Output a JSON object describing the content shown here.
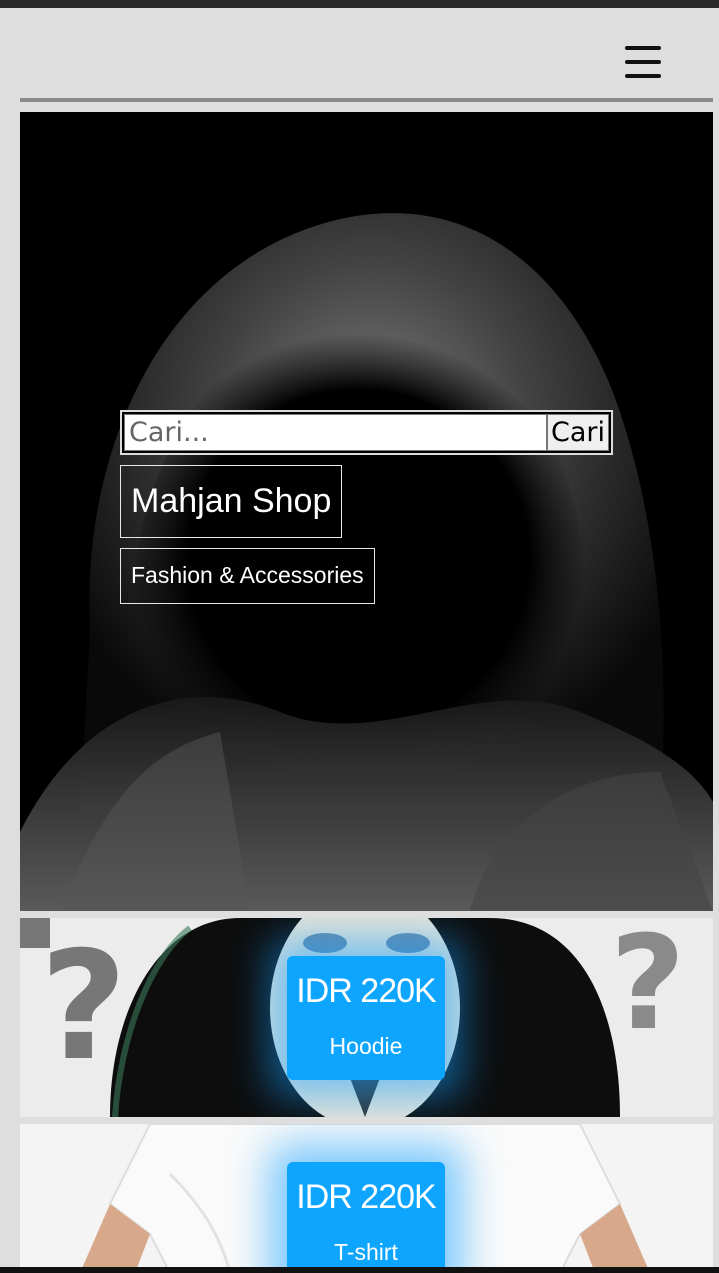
{
  "header": {
    "menu_icon": "hamburger-menu-icon"
  },
  "hero": {
    "search": {
      "placeholder": "Cari...",
      "button_label": "Cari"
    },
    "brand_name": "Mahjan Shop",
    "tagline": "Fashion & Accessories"
  },
  "products": [
    {
      "price": "IDR 220K",
      "name": "Hoodie"
    },
    {
      "price": "IDR 220K",
      "name": "T-shirt"
    }
  ],
  "colors": {
    "accent": "#0ea5ff",
    "page_bg": "#dedede",
    "hero_bg": "#000000"
  }
}
